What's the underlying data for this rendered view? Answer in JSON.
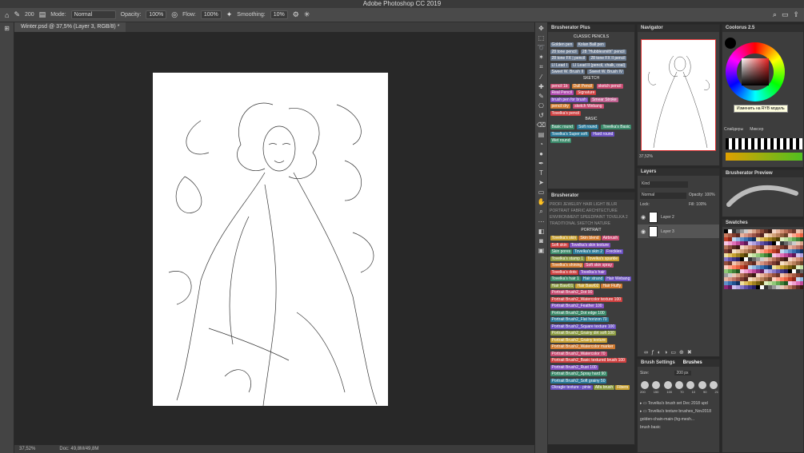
{
  "app": {
    "title": "Adobe Photoshop CC 2019"
  },
  "options_bar": {
    "mode_label": "Mode:",
    "mode_value": "Normal",
    "opacity_label": "Opacity:",
    "opacity_value": "100%",
    "flow_label": "Flow:",
    "flow_value": "100%",
    "smoothing_label": "Smoothing:",
    "smoothing_value": "10%",
    "brush_size": "200"
  },
  "document": {
    "tab": "Winter.psd @ 37,5% (Layer 3, RGB/8) *",
    "zoom": "37,52%",
    "doc_info": "Doc: 49,8M/49,8M"
  },
  "brusherator_plus": {
    "title": "Brusherator Plus",
    "section_classic": "CLASSIC PENCILS",
    "classic": [
      "Golden pen",
      "Kolan Ball pen",
      "28 tone pencil",
      "28 \"Hubblesmith\" pencil",
      "28 tone FX | pencil",
      "28 tone FX II pencil",
      "LI Lead I",
      "LI Lead II (pencil, chalk, coal)",
      "Sweet W. Brush II",
      "Sweet W. Brush IV"
    ],
    "section_sketch": "SKETCH",
    "sketch": [
      "pencil 1b",
      "Dull Pencil",
      "sketch pencil",
      "Real Pencil",
      "Signature",
      "brush pen for brush",
      "Smear Stroke",
      "pencil dry",
      "sketch Webang",
      "Tovelka's pencil"
    ],
    "section_basic": "BASIC",
    "basic": [
      "Basic round",
      "Soft round",
      "Tovelka's Basic",
      "Tovelka's Super soft",
      "Hard round",
      "Wet round"
    ]
  },
  "brusherator": {
    "title": "Brusherator",
    "categories_line": "PROFI  JEWELRY  HAIR  LIGHT BLUR",
    "categories_line2": "PORTRAIT  FABRIC  ARCHITECTURE",
    "categories_line3": "ENVIRONMENT  SPEEDPAINT  TOVELKA 2",
    "categories_line4": "TRADITIONAL  SKETCH  NATURE",
    "section_portrait": "PORTRAIT",
    "portrait": [
      "Tovelka's skin",
      "Skin blend",
      "Airbrush",
      "Soft skin",
      "Tovelka's skin texture",
      "Skin pores",
      "Tovelka's skin 2",
      "Freckles",
      "Tovelka's stamp 1",
      "Tovelka's sparkle",
      "Tovelka's shining",
      "Soft skin spray",
      "Tovelka's dots",
      "Tovelka's hair",
      "Tovelka's hair 1",
      "Hair strand",
      "Hair Webang",
      "Hair Bawl01",
      "Hair Bawl02",
      "Hair Fluffy",
      "Portrait Brush2_Dot 90",
      "Portrait Brush2_Watercolor texture 100",
      "Portrait Brush2_Feather 100",
      "Portrait Brush2_Dot edge 100",
      "Portrait Brush2_Flat horizon 70",
      "Portrait Brush2_Square texture 100",
      "Portrait Brush2_Grainy dirt soft 100",
      "Portrait Brush2_Grainy texture",
      "Portrait Brush2_Watercolor marker",
      "Portrait Brush2_Watercolor 70",
      "Portrait Brush2_Basic textured brush 100",
      "Portrait Brush2_Rust 100",
      "Portrait Brush2_Spray hard 90",
      "Portrait Brush2_Soft grainy 50",
      "Okragle texture - pinie",
      "Alfa brush",
      "Fibers"
    ]
  },
  "navigator": {
    "title": "Navigator",
    "zoom": "37,52%"
  },
  "layers": {
    "title": "Layers",
    "kind": "Kind",
    "blend": "Normal",
    "opacity_label": "Opacity:",
    "opacity_value": "100%",
    "lock_label": "Lock:",
    "fill_label": "Fill:",
    "fill_value": "100%",
    "rows": [
      {
        "name": "Layer 2"
      },
      {
        "name": "Layer 3"
      }
    ]
  },
  "brush_settings": {
    "tab1": "Brush Settings",
    "tab2": "Brushes",
    "size_label": "Size:",
    "size_value": "200 px",
    "sizes": [
      "200",
      "150",
      "100",
      "70",
      "10",
      "90",
      "21"
    ],
    "groups": [
      "Tovelka's brush set Dec 2018 upd",
      "Tovelka's texture brushes_Nov2018",
      "golden-chain-main-(hg-mesh...",
      "brush basic"
    ]
  },
  "coolorus": {
    "title": "Coolorus 2.5",
    "tooltip": "Изменить на RYB модель",
    "tab1": "Слайдеры",
    "tab2": "Миксер"
  },
  "brusherator_preview": {
    "title": "Brusherator Preview"
  },
  "swatches": {
    "title": "Swatches",
    "colors": [
      "#000",
      "#fff",
      "#333",
      "#666",
      "#999",
      "#ccc",
      "#e8c9b8",
      "#d9a38a",
      "#b7735a",
      "#8a4a3a",
      "#5c2e23",
      "#3a1a14",
      "#f4d7c7",
      "#e9b79f",
      "#d49176",
      "#b96f56",
      "#96503e",
      "#6e3629",
      "#f0c5b0",
      "#e3a084",
      "#c97c60",
      "#a75b44",
      "#833f2f",
      "#5e2820",
      "#e8b4a0",
      "#d69382",
      "#bd7465",
      "#9c5448",
      "#7a3a32",
      "#532420",
      "#f5e0c8",
      "#e8c4a0",
      "#d4a27a",
      "#b8805a",
      "#93603f",
      "#6b4229",
      "#ffd0c0",
      "#ffa890",
      "#ff8060",
      "#e86040",
      "#c04028",
      "#902818",
      "#c0d8f0",
      "#90b8e0",
      "#6090c8",
      "#3870b0",
      "#205090",
      "#103060",
      "#f0e0a0",
      "#e0c060",
      "#c8a030",
      "#a08020",
      "#786010",
      "#504008",
      "#e0f0c0",
      "#c0e0a0",
      "#90c878",
      "#60a850",
      "#408038",
      "#205820",
      "#f8c8e8",
      "#f0a0d0",
      "#e070b8",
      "#c04898",
      "#902878",
      "#601858",
      "#d0c0f0",
      "#b0a0e0",
      "#8878c8",
      "#6050a8",
      "#403888",
      "#282068"
    ]
  }
}
